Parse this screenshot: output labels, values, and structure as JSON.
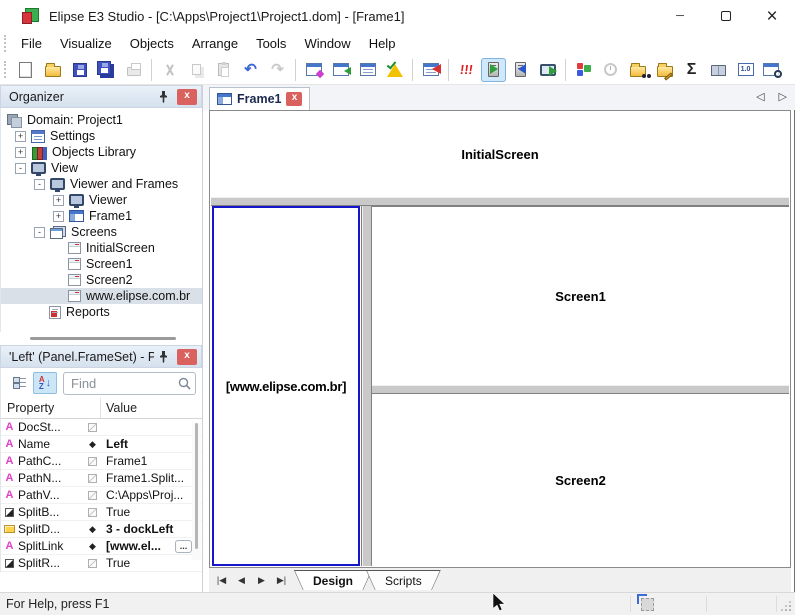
{
  "window": {
    "title": "Elipse E3 Studio - [C:\\Apps\\Project1\\Project1.dom] - [Frame1]"
  },
  "menu": {
    "items": [
      "File",
      "Visualize",
      "Objects",
      "Arrange",
      "Tools",
      "Window",
      "Help"
    ]
  },
  "toolbar": {
    "icons": [
      "new",
      "open",
      "save",
      "save-all",
      "print",
      "cut",
      "copy",
      "paste",
      "undo",
      "redo",
      "insert-screen",
      "import-screen",
      "screen-gallery",
      "verify-domain",
      "domain-options",
      "critical-alarms",
      "run-application",
      "run-studio",
      "run-viewer",
      "organizer",
      "watch",
      "find-in-domain",
      "edit-domain",
      "sum",
      "documentation",
      "decimal-places",
      "window-zoom"
    ]
  },
  "organizer": {
    "title": "Organizer",
    "tree": [
      {
        "label": "Domain: Project1",
        "icon": "domain",
        "expand": ""
      },
      {
        "label": "Settings",
        "icon": "settings",
        "expand": "+"
      },
      {
        "label": "Objects Library",
        "icon": "library",
        "expand": "+"
      },
      {
        "label": "View",
        "icon": "monitor",
        "expand": "-"
      },
      {
        "label": "Viewer and Frames",
        "icon": "monitor",
        "expand": "-"
      },
      {
        "label": "Viewer",
        "icon": "monitor",
        "expand": "+"
      },
      {
        "label": "Frame1",
        "icon": "frame",
        "expand": "+"
      },
      {
        "label": "Screens",
        "icon": "screens",
        "expand": "-"
      },
      {
        "label": "InitialScreen",
        "icon": "screen",
        "expand": ""
      },
      {
        "label": "Screen1",
        "icon": "screen",
        "expand": ""
      },
      {
        "label": "Screen2",
        "icon": "screen",
        "expand": ""
      },
      {
        "label": "www.elipse.com.br",
        "icon": "screen",
        "expand": "",
        "selected": true
      },
      {
        "label": "Reports",
        "icon": "reports",
        "expand": ""
      }
    ]
  },
  "properties": {
    "title": "'Left' (Panel.FrameSet) - Pr...",
    "find_placeholder": "Find",
    "columns": [
      "Property",
      "Value"
    ],
    "ellipsis_label": "...",
    "rows": [
      {
        "name": "DocSt...",
        "type": "string",
        "flag": "edit",
        "value": ""
      },
      {
        "name": "Name",
        "type": "string",
        "flag": "set",
        "value": "Left",
        "bold": true
      },
      {
        "name": "PathC...",
        "type": "string",
        "flag": "edit",
        "value": "Frame1"
      },
      {
        "name": "PathN...",
        "type": "string",
        "flag": "edit",
        "value": "Frame1.Split..."
      },
      {
        "name": "PathV...",
        "type": "string",
        "flag": "edit",
        "value": "C:\\Apps\\Proj..."
      },
      {
        "name": "SplitB...",
        "type": "bool",
        "flag": "edit",
        "value": "True"
      },
      {
        "name": "SplitD...",
        "type": "enum",
        "flag": "set",
        "value": "3 - dockLeft",
        "bold": true
      },
      {
        "name": "SplitLink",
        "type": "string",
        "flag": "set",
        "value": "[www.el...",
        "bold": true,
        "has_ellipsis": true
      },
      {
        "name": "SplitR...",
        "type": "bool",
        "flag": "edit",
        "value": "True"
      }
    ]
  },
  "main": {
    "tab_label": "Frame1",
    "frames": {
      "top": "InitialScreen",
      "left": "[www.elipse.com.br]",
      "right_top": "Screen1",
      "right_bottom": "Screen2"
    },
    "sheet_tabs": [
      "Design",
      "Scripts"
    ]
  },
  "statusbar": {
    "help_text": "For Help, press F1"
  }
}
